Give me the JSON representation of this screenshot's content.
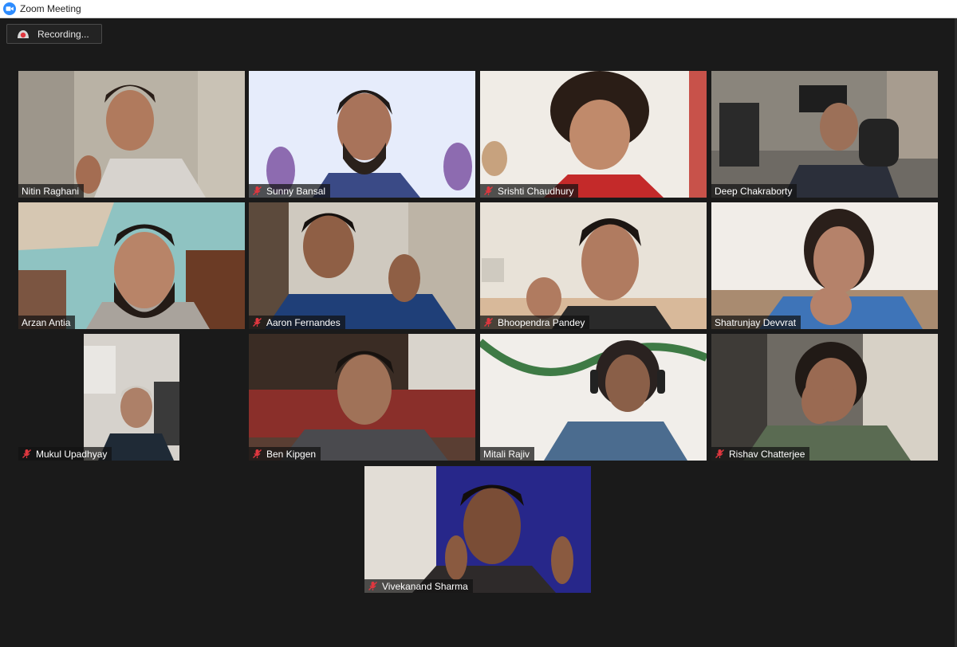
{
  "window": {
    "title": "Zoom Meeting",
    "app_icon": "zoom-camera-icon"
  },
  "recording": {
    "label": "Recording...",
    "icon": "recording-indicator-icon"
  },
  "colors": {
    "background": "#1a1a1a",
    "mute": "#e0373f",
    "zoom_blue": "#2d8cff"
  },
  "participants": [
    {
      "name": "Nitin Raghani",
      "muted": false
    },
    {
      "name": "Sunny Bansal",
      "muted": true
    },
    {
      "name": "Srishti Chaudhury",
      "muted": true
    },
    {
      "name": "Deep Chakraborty",
      "muted": false
    },
    {
      "name": "Arzan Antia",
      "muted": false
    },
    {
      "name": "Aaron Fernandes",
      "muted": true
    },
    {
      "name": "Bhoopendra Pandey",
      "muted": true
    },
    {
      "name": "Shatrunjay Devvrat",
      "muted": false
    },
    {
      "name": "Mukul Upadhyay",
      "muted": true
    },
    {
      "name": "Ben Kipgen",
      "muted": true
    },
    {
      "name": "Mitali Rajiv",
      "muted": false
    },
    {
      "name": "Rishav Chatterjee",
      "muted": true
    },
    {
      "name": "Vivekanand Sharma",
      "muted": true
    }
  ]
}
